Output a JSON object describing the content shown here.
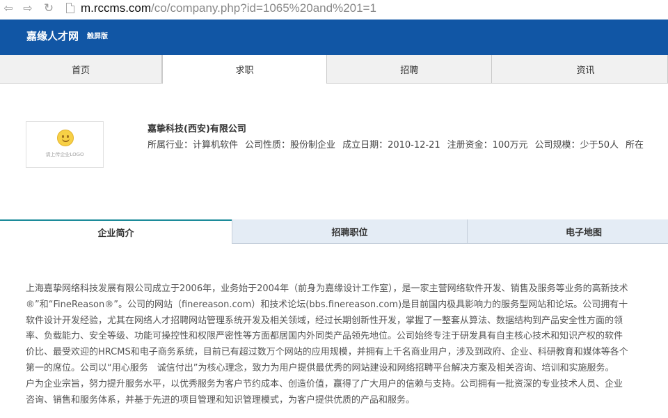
{
  "browser": {
    "back_glyph": "⇦",
    "forward_glyph": "⇨",
    "reload_glyph": "↻",
    "url_host": "m.rccms.com",
    "url_path": "/co/company.php?id=1065%20and%201=1"
  },
  "header": {
    "title": "嘉缘人才网",
    "subtitle": "触屏版",
    "bg_color": "#1156a5"
  },
  "main_tabs": [
    {
      "label": "首页",
      "active": false
    },
    {
      "label": "求职",
      "active": true
    },
    {
      "label": "招聘",
      "active": false
    },
    {
      "label": "资讯",
      "active": false
    }
  ],
  "company": {
    "logo_caption": "请上传企业LOGO",
    "name": "嘉挚科技(西安)有限公司",
    "meta": [
      {
        "label": "所属行业：",
        "value": "计算机软件"
      },
      {
        "label": "公司性质：",
        "value": "股份制企业"
      },
      {
        "label": "成立日期：",
        "value": "2010-12-21"
      },
      {
        "label": "注册资金：",
        "value": "100万元"
      },
      {
        "label": "公司规模：",
        "value": "少于50人"
      },
      {
        "label": "所在",
        "value": ""
      }
    ]
  },
  "sub_tabs": [
    {
      "label": "企业简介",
      "active": true
    },
    {
      "label": "招聘职位",
      "active": false
    },
    {
      "label": "电子地图",
      "active": false
    }
  ],
  "intro_lines": [
    "上海嘉挚网络科技发展有限公司成立于2006年，业务始于2004年（前身为嘉缘设计工作室），是一家主营网络软件开发、销售及服务等业务的高新技术",
    "®”和“FineReason®”。公司的网站（finereason.com）和技术论坛(bbs.finereason.com)是目前国内极具影响力的服务型网站和论坛。公司拥有十",
    "软件设计开发经验，尤其在网络人才招聘网站管理系统开发及相关领域，经过长期创新性开发，掌握了一整套从算法、数据结构到产品安全性方面的领",
    "率、负载能力、安全等级、功能可操控性和权限严密性等方面都居国内外同类产品领先地位。公司始终专注于研发具有自主核心技术和知识产权的软件",
    "价比、最受欢迎的HRCMS和电子商务系统，目前已有超过数万个网站的应用规模，并拥有上千名商业用户，涉及到政府、企业、科研教育和媒体等各个",
    "第一的席位。公司以“用心服务　诚信付出”为核心理念，致力为用户提供最优秀的网站建设和网络招聘平台解决方案及相关咨询、培训和实施服务。",
    "户为企业宗旨，努力提升服务水平，以优秀服务为客户节约成本、创造价值，赢得了广大用户的信赖与支持。公司拥有一批资深的专业技术人员、企业",
    "咨询、销售和服务体系，并基于先进的项目管理和知识管理模式，为客户提供优质的产品和服务。"
  ]
}
